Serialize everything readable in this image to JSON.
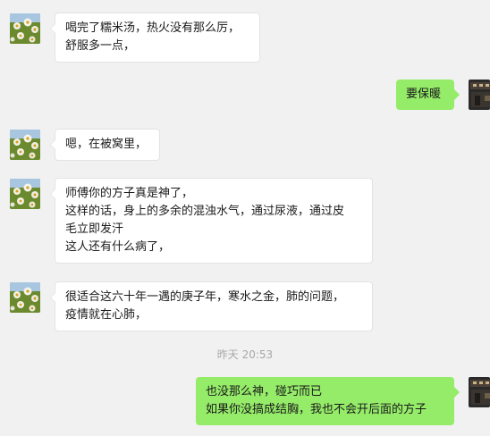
{
  "messages": [
    {
      "lines": [
        "喝完了糯米汤，热火没有那么厉，",
        "舒服多一点，"
      ]
    },
    {
      "lines": [
        "要保暖"
      ]
    },
    {
      "lines": [
        "嗯，在被窝里，"
      ]
    },
    {
      "lines": [
        "师傅你的方子真是神了，",
        "这样的话，身上的多余的混浊水气，通过尿液，通过皮",
        "毛立即发汗",
        "这人还有什么病了，"
      ]
    },
    {
      "lines": [
        "很适合这六十年一遇的庚子年，寒水之金，肺的问题，",
        "疫情就在心肺，"
      ]
    },
    {
      "lines": [
        "也没那么神，碰巧而已",
        "如果你没搞成结胸，我也不会开后面的方子"
      ]
    }
  ],
  "timestamp": "昨天 20:53",
  "colors": {
    "background": "#f1f1f1",
    "incoming_bubble": "#ffffff",
    "outgoing_bubble": "#95ec69",
    "timestamp_text": "#a8a8a8"
  },
  "icons": {
    "contact_avatar": "flower-field-avatar",
    "self_avatar": "dark-photo-avatar"
  }
}
